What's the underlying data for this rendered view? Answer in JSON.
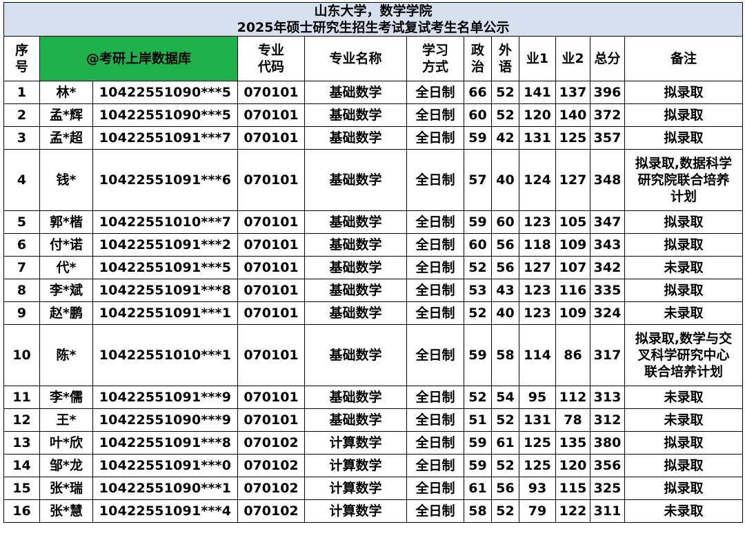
{
  "title": {
    "line1": "山东大学，数学学院",
    "line2": "2025年硕士研究生招生考试复试考生名单公示"
  },
  "headers": {
    "seq": [
      "序",
      "号"
    ],
    "brand": "@考研上岸数据库",
    "major_code": [
      "专业",
      "代码"
    ],
    "major_name": "专业名称",
    "study_mode": [
      "学习",
      "方式"
    ],
    "politics": [
      "政",
      "治"
    ],
    "foreign": [
      "外",
      "语"
    ],
    "sub1": "业1",
    "sub2": "业2",
    "total": "总分",
    "note": "备注"
  },
  "rows": [
    {
      "seq": "1",
      "name": "林*",
      "id": "10422551090***5",
      "code": "070101",
      "major": "基础数学",
      "mode": "全日制",
      "politics": "66",
      "foreign": "52",
      "s1": "141",
      "s2": "137",
      "total": "396",
      "note": [
        "拟录取"
      ]
    },
    {
      "seq": "2",
      "name": "孟*辉",
      "id": "10422551090***5",
      "code": "070101",
      "major": "基础数学",
      "mode": "全日制",
      "politics": "60",
      "foreign": "52",
      "s1": "120",
      "s2": "140",
      "total": "372",
      "note": [
        "拟录取"
      ]
    },
    {
      "seq": "3",
      "name": "孟*超",
      "id": "10422551091***7",
      "code": "070101",
      "major": "基础数学",
      "mode": "全日制",
      "politics": "59",
      "foreign": "42",
      "s1": "131",
      "s2": "125",
      "total": "357",
      "note": [
        "拟录取"
      ]
    },
    {
      "seq": "4",
      "name": "钱*",
      "id": "10422551091***6",
      "code": "070101",
      "major": "基础数学",
      "mode": "全日制",
      "politics": "57",
      "foreign": "40",
      "s1": "124",
      "s2": "127",
      "total": "348",
      "note": [
        "拟录取,数据科学",
        "研究院联合培养",
        "计划"
      ]
    },
    {
      "seq": "5",
      "name": "郭*楷",
      "id": "10422551010***7",
      "code": "070101",
      "major": "基础数学",
      "mode": "全日制",
      "politics": "59",
      "foreign": "60",
      "s1": "123",
      "s2": "105",
      "total": "347",
      "note": [
        "拟录取"
      ]
    },
    {
      "seq": "6",
      "name": "付*诺",
      "id": "10422551091***2",
      "code": "070101",
      "major": "基础数学",
      "mode": "全日制",
      "politics": "60",
      "foreign": "56",
      "s1": "118",
      "s2": "109",
      "total": "343",
      "note": [
        "拟录取"
      ]
    },
    {
      "seq": "7",
      "name": "代*",
      "id": "10422551091***5",
      "code": "070101",
      "major": "基础数学",
      "mode": "全日制",
      "politics": "52",
      "foreign": "56",
      "s1": "127",
      "s2": "107",
      "total": "342",
      "note": [
        "未录取"
      ]
    },
    {
      "seq": "8",
      "name": "李*斌",
      "id": "10422551091***8",
      "code": "070101",
      "major": "基础数学",
      "mode": "全日制",
      "politics": "53",
      "foreign": "43",
      "s1": "123",
      "s2": "116",
      "total": "335",
      "note": [
        "拟录取"
      ]
    },
    {
      "seq": "9",
      "name": "赵*鹏",
      "id": "10422551091***1",
      "code": "070101",
      "major": "基础数学",
      "mode": "全日制",
      "politics": "52",
      "foreign": "40",
      "s1": "123",
      "s2": "109",
      "total": "324",
      "note": [
        "未录取"
      ]
    },
    {
      "seq": "10",
      "name": "陈*",
      "id": "10422551010***1",
      "code": "070101",
      "major": "基础数学",
      "mode": "全日制",
      "politics": "59",
      "foreign": "58",
      "s1": "114",
      "s2": "86",
      "total": "317",
      "note": [
        "拟录取,数学与交",
        "叉科学研究中心",
        "联合培养计划"
      ]
    },
    {
      "seq": "11",
      "name": "李*儒",
      "id": "10422551091***9",
      "code": "070101",
      "major": "基础数学",
      "mode": "全日制",
      "politics": "52",
      "foreign": "54",
      "s1": "95",
      "s2": "112",
      "total": "313",
      "note": [
        "未录取"
      ]
    },
    {
      "seq": "12",
      "name": "王*",
      "id": "10422551090***9",
      "code": "070101",
      "major": "基础数学",
      "mode": "全日制",
      "politics": "51",
      "foreign": "52",
      "s1": "131",
      "s2": "78",
      "total": "312",
      "note": [
        "未录取"
      ]
    },
    {
      "seq": "13",
      "name": "叶*欣",
      "id": "10422551091***8",
      "code": "070102",
      "major": "计算数学",
      "mode": "全日制",
      "politics": "59",
      "foreign": "61",
      "s1": "125",
      "s2": "135",
      "total": "380",
      "note": [
        "拟录取"
      ]
    },
    {
      "seq": "14",
      "name": "邹*龙",
      "id": "10422551091***0",
      "code": "070102",
      "major": "计算数学",
      "mode": "全日制",
      "politics": "59",
      "foreign": "52",
      "s1": "125",
      "s2": "120",
      "total": "356",
      "note": [
        "拟录取"
      ]
    },
    {
      "seq": "15",
      "name": "张*瑞",
      "id": "10422551090***1",
      "code": "070102",
      "major": "计算数学",
      "mode": "全日制",
      "politics": "61",
      "foreign": "56",
      "s1": "93",
      "s2": "115",
      "total": "325",
      "note": [
        "拟录取"
      ]
    },
    {
      "seq": "16",
      "name": "张*慧",
      "id": "10422551091***4",
      "code": "070102",
      "major": "计算数学",
      "mode": "全日制",
      "politics": "58",
      "foreign": "52",
      "s1": "79",
      "s2": "122",
      "total": "311",
      "note": [
        "未录取"
      ]
    }
  ],
  "colors": {
    "title_bg": "#d6e0ef",
    "brand_bg": "#1fb14c",
    "border": "#000000"
  }
}
